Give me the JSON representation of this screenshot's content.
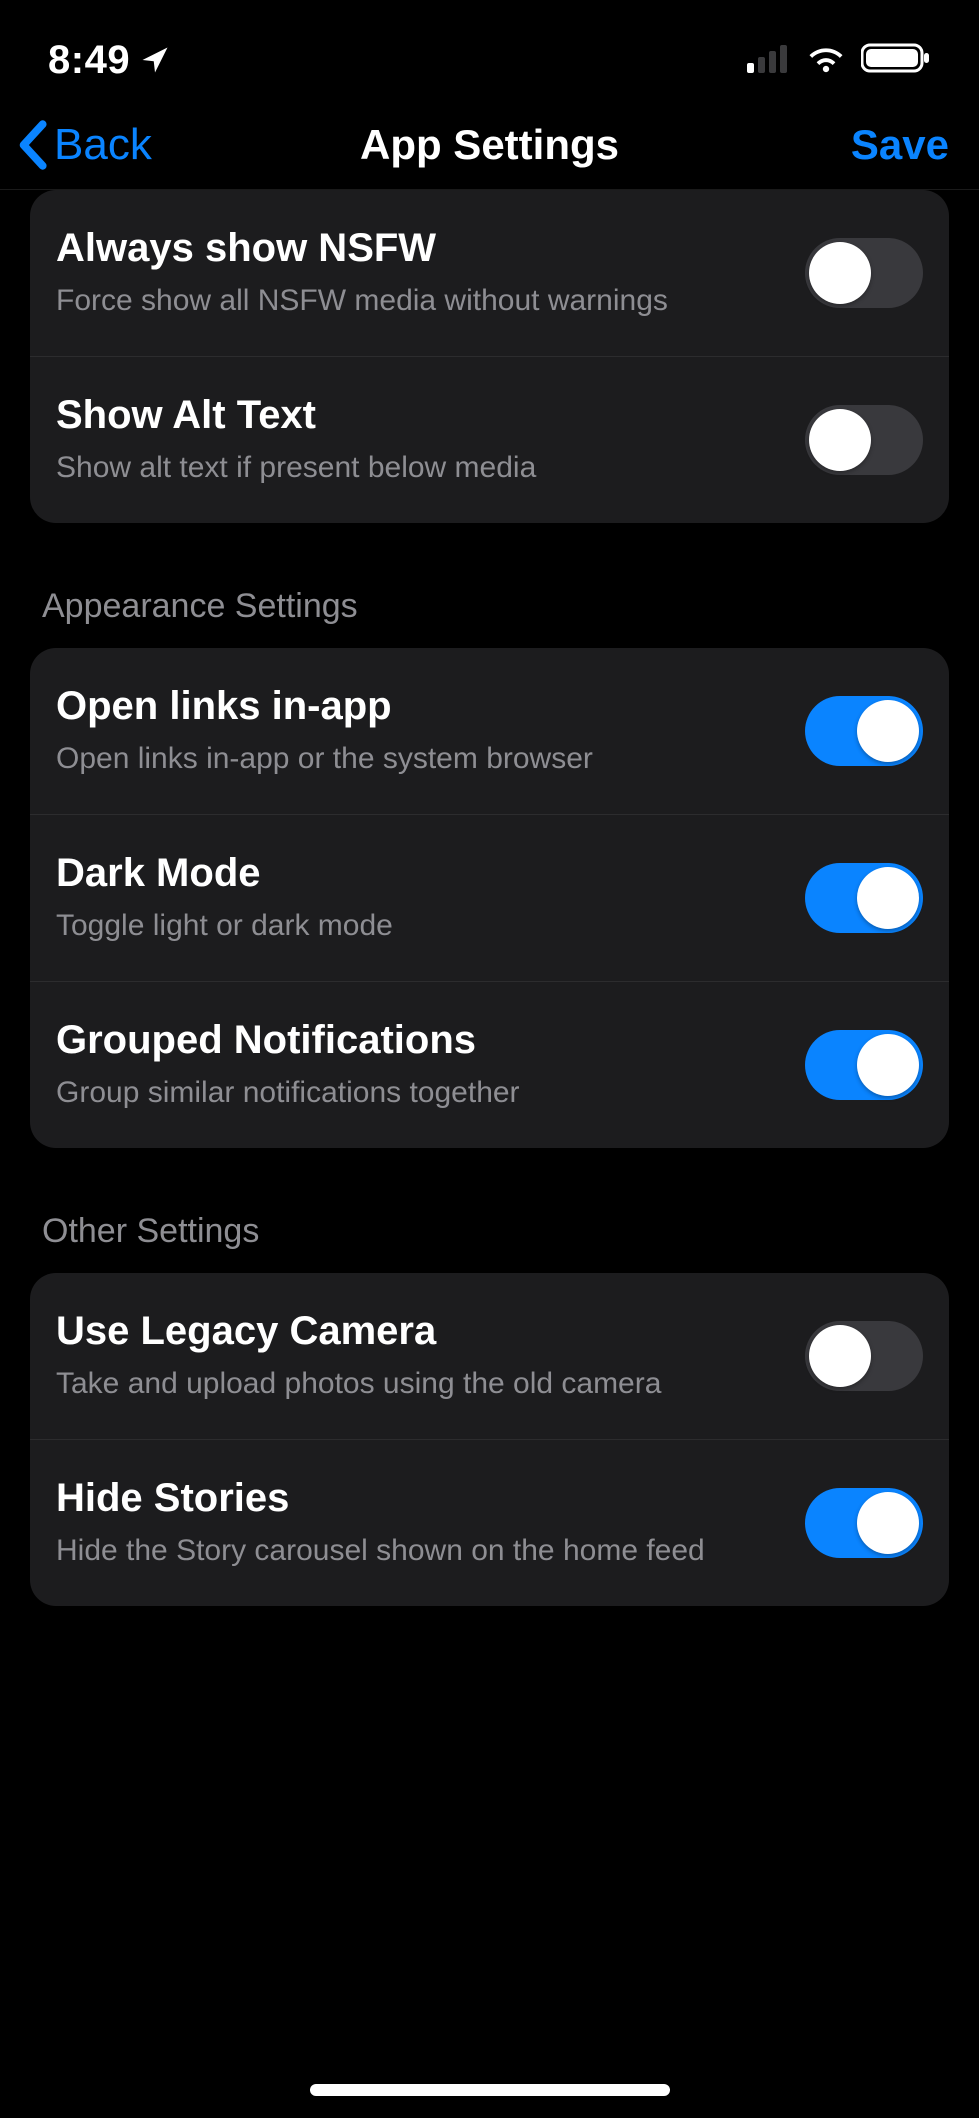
{
  "status": {
    "time": "8:49"
  },
  "nav": {
    "back_label": "Back",
    "title": "App Settings",
    "save_label": "Save"
  },
  "sections": {
    "first_group": {
      "items": [
        {
          "title": "Always show NSFW",
          "subtitle": "Force show all NSFW media without warnings",
          "on": false
        },
        {
          "title": "Show Alt Text",
          "subtitle": "Show alt text if present below media",
          "on": false
        }
      ]
    },
    "appearance": {
      "header": "Appearance Settings",
      "items": [
        {
          "title": "Open links in-app",
          "subtitle": "Open links in-app or the system browser",
          "on": true
        },
        {
          "title": "Dark Mode",
          "subtitle": "Toggle light or dark mode",
          "on": true
        },
        {
          "title": "Grouped Notifications",
          "subtitle": "Group similar notifications together",
          "on": true
        }
      ]
    },
    "other": {
      "header": "Other Settings",
      "items": [
        {
          "title": "Use Legacy Camera",
          "subtitle": "Take and upload photos using the old camera",
          "on": false
        },
        {
          "title": "Hide Stories",
          "subtitle": "Hide the Story carousel shown on the home feed",
          "on": true
        }
      ]
    }
  }
}
